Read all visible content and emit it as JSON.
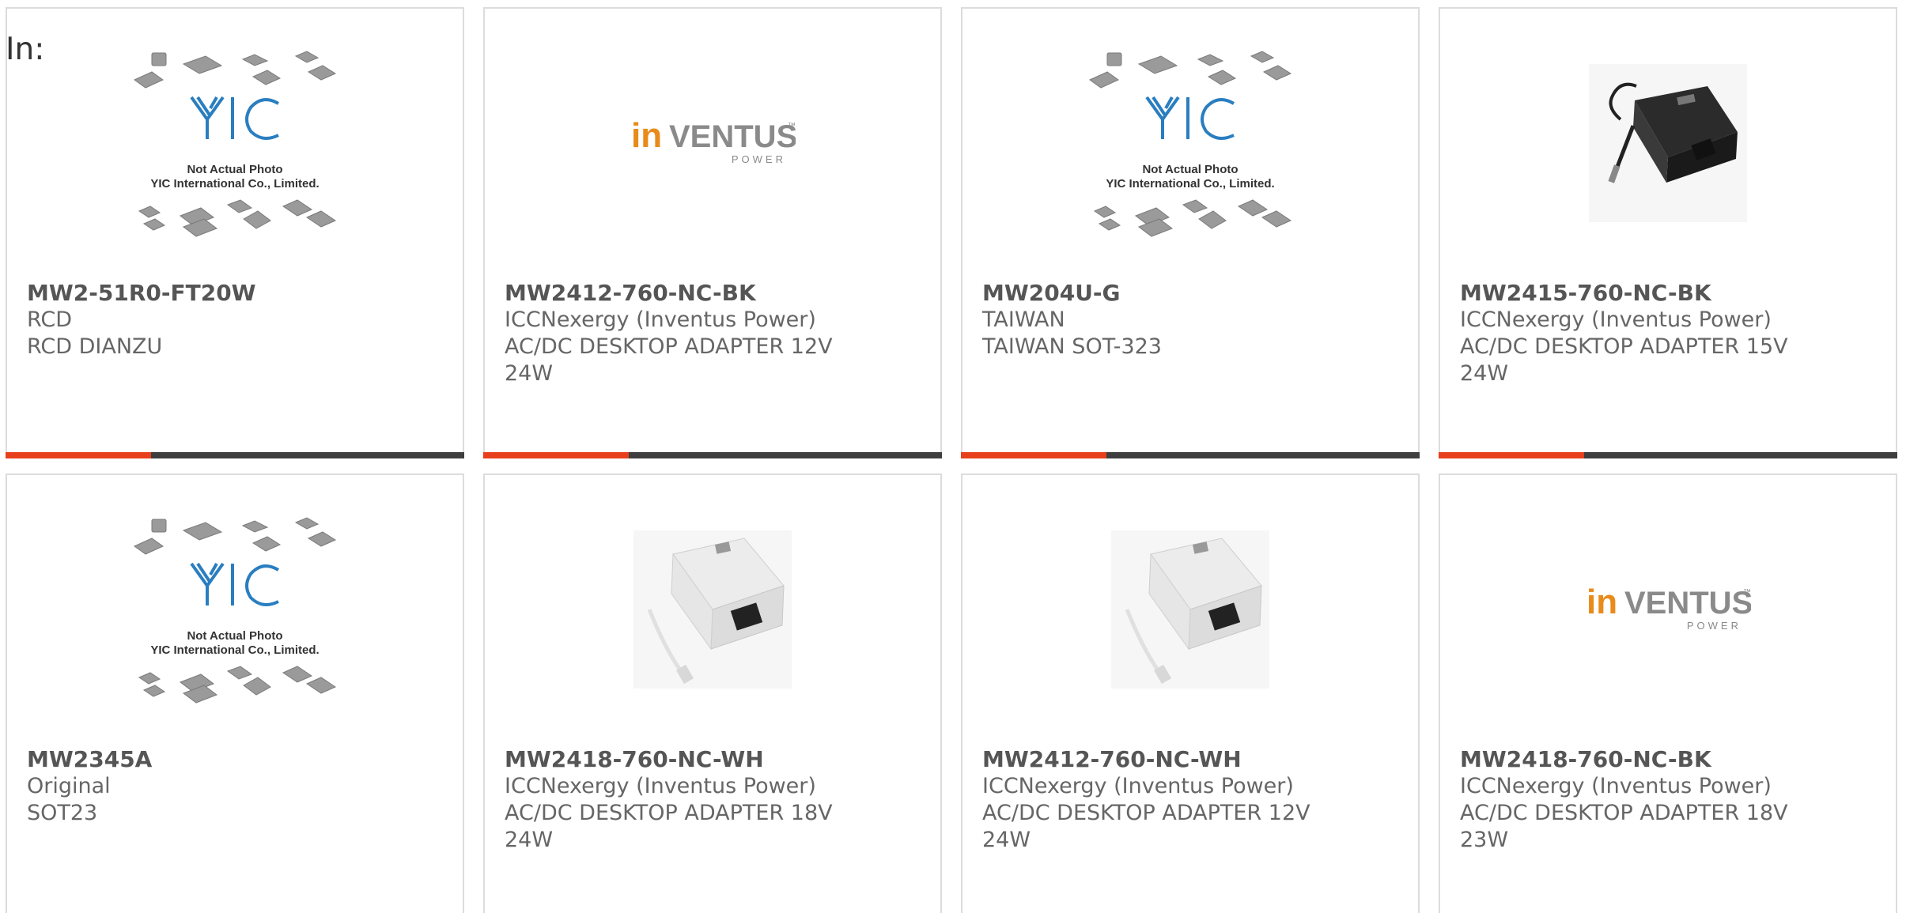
{
  "header": {
    "label": "In:"
  },
  "colors": {
    "accent": "#e8401c",
    "bar": "#3e3e3e",
    "border": "#dcdcdc",
    "text": "#666666"
  },
  "yic": {
    "line1": "Not Actual Photo",
    "line2": "YIC International Co., Limited.",
    "logo": "YIC"
  },
  "inventus": {
    "brand_in": "in",
    "brand_rest": "VENTUS",
    "tm": "™",
    "sub": "POWER"
  },
  "products": [
    {
      "part": "MW2-51R0-FT20W",
      "line1": "RCD",
      "line2": "RCD DIANZU",
      "line3": "",
      "image": "yic-placeholder-image",
      "progress_visible": true
    },
    {
      "part": "MW2412-760-NC-BK",
      "line1": "ICCNexergy (Inventus Power)",
      "line2": "AC/DC DESKTOP ADAPTER 12V",
      "line3": "24W",
      "image": "inventus-logo-image",
      "progress_visible": true
    },
    {
      "part": "MW204U-G",
      "line1": "TAIWAN",
      "line2": "TAIWAN SOT-323",
      "line3": "",
      "image": "yic-placeholder-image",
      "progress_visible": true
    },
    {
      "part": "MW2415-760-NC-BK",
      "line1": "ICCNexergy (Inventus Power)",
      "line2": "AC/DC DESKTOP ADAPTER 15V",
      "line3": "24W",
      "image": "black-adapter-image",
      "progress_visible": true
    },
    {
      "part": "MW2345A",
      "line1": "Original",
      "line2": "SOT23",
      "line3": "",
      "image": "yic-placeholder-image",
      "progress_visible": false
    },
    {
      "part": "MW2418-760-NC-WH",
      "line1": "ICCNexergy (Inventus Power)",
      "line2": "AC/DC DESKTOP ADAPTER 18V",
      "line3": "24W",
      "image": "white-adapter-image",
      "progress_visible": false
    },
    {
      "part": "MW2412-760-NC-WH",
      "line1": "ICCNexergy (Inventus Power)",
      "line2": "AC/DC DESKTOP ADAPTER 12V",
      "line3": "24W",
      "image": "white-adapter-image",
      "progress_visible": false
    },
    {
      "part": "MW2418-760-NC-BK",
      "line1": "ICCNexergy (Inventus Power)",
      "line2": "AC/DC DESKTOP ADAPTER 18V",
      "line3": "23W",
      "image": "inventus-logo-image",
      "progress_visible": false
    }
  ]
}
